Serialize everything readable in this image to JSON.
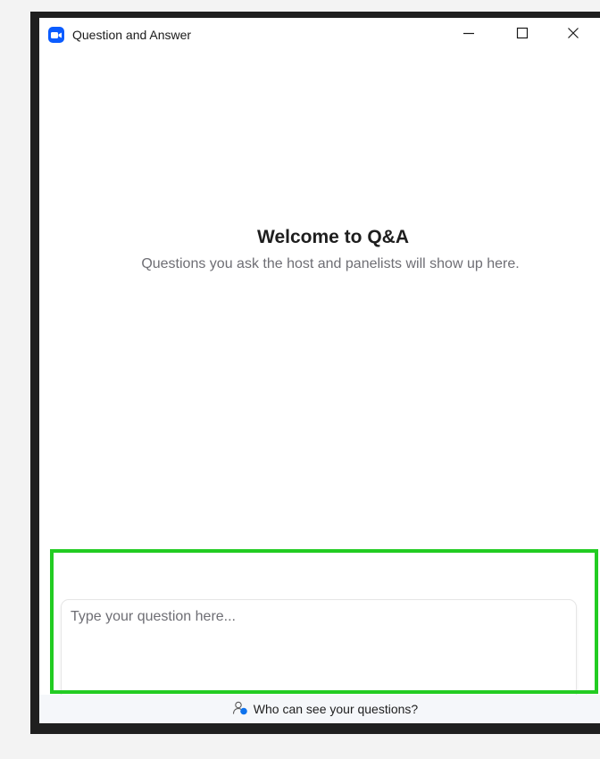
{
  "window": {
    "title": "Question and Answer",
    "controls": {
      "minimize_icon": "minimize-icon",
      "maximize_icon": "maximize-icon",
      "close_icon": "close-icon"
    }
  },
  "welcome": {
    "title": "Welcome to Q&A",
    "subtitle": "Questions you ask the host and panelists will show up here."
  },
  "question": {
    "placeholder": "Type your question here...",
    "value": ""
  },
  "footer": {
    "visibility_link": "Who can see your questions?",
    "icon": "person-info-icon"
  },
  "colors": {
    "app_icon": "#0b5cff",
    "highlight": "#22cc22",
    "title_text": "#1e1e1e",
    "muted_text": "#6e6e74"
  }
}
